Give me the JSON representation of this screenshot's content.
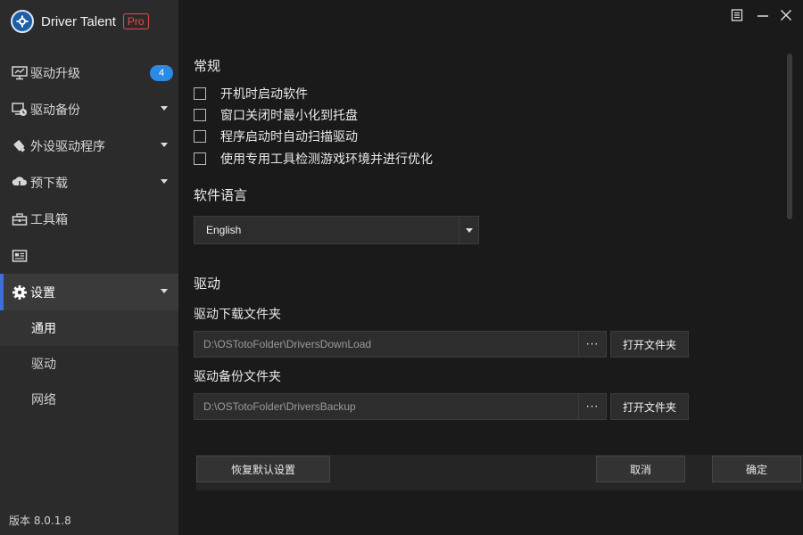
{
  "app": {
    "name": "Driver Talent",
    "edition": "Pro",
    "version": "版本 8.0.1.8"
  },
  "window_controls": {
    "menu_icon": "menu-icon",
    "minimize_icon": "minimize-icon",
    "close_icon": "close-icon"
  },
  "sidebar": {
    "items": [
      {
        "label": "驱动升级",
        "icon": "monitor-icon",
        "badge": "4"
      },
      {
        "label": "驱动备份",
        "icon": "backup-icon"
      },
      {
        "label": "外设驱动程序",
        "icon": "peripheral-icon"
      },
      {
        "label": "预下载",
        "icon": "cloud-download-icon"
      },
      {
        "label": "工具箱",
        "icon": "toolbox-icon"
      },
      {
        "label": "",
        "icon": "news-icon"
      },
      {
        "label": "设置",
        "icon": "gear-icon"
      }
    ],
    "sub_items": [
      {
        "label": "通用"
      },
      {
        "label": "驱动"
      },
      {
        "label": "网络"
      }
    ]
  },
  "settings": {
    "general": {
      "title": "常规",
      "options": [
        {
          "label": "开机时启动软件",
          "checked": false
        },
        {
          "label": "窗口关闭时最小化到托盘",
          "checked": false
        },
        {
          "label": "程序启动时自动扫描驱动",
          "checked": false
        },
        {
          "label": "使用专用工具检测游戏环境并进行优化",
          "checked": false
        }
      ]
    },
    "language": {
      "title": "软件语言",
      "selected": "English"
    },
    "driver": {
      "title": "驱动",
      "download_folder": {
        "label": "驱动下载文件夹",
        "value": "D:\\OSTotoFolder\\DriversDownLoad",
        "browse_label": "···",
        "open_label": "打开文件夹"
      },
      "backup_folder": {
        "label": "驱动备份文件夹",
        "value": "D:\\OSTotoFolder\\DriversBackup",
        "browse_label": "···",
        "open_label": "打开文件夹"
      }
    }
  },
  "footer": {
    "restore_label": "恢复默认设置",
    "cancel_label": "取消",
    "confirm_label": "确定"
  },
  "colors": {
    "accent": "#3f6fd8",
    "badge": "#2a8ae6",
    "pro": "#e84a4a"
  }
}
